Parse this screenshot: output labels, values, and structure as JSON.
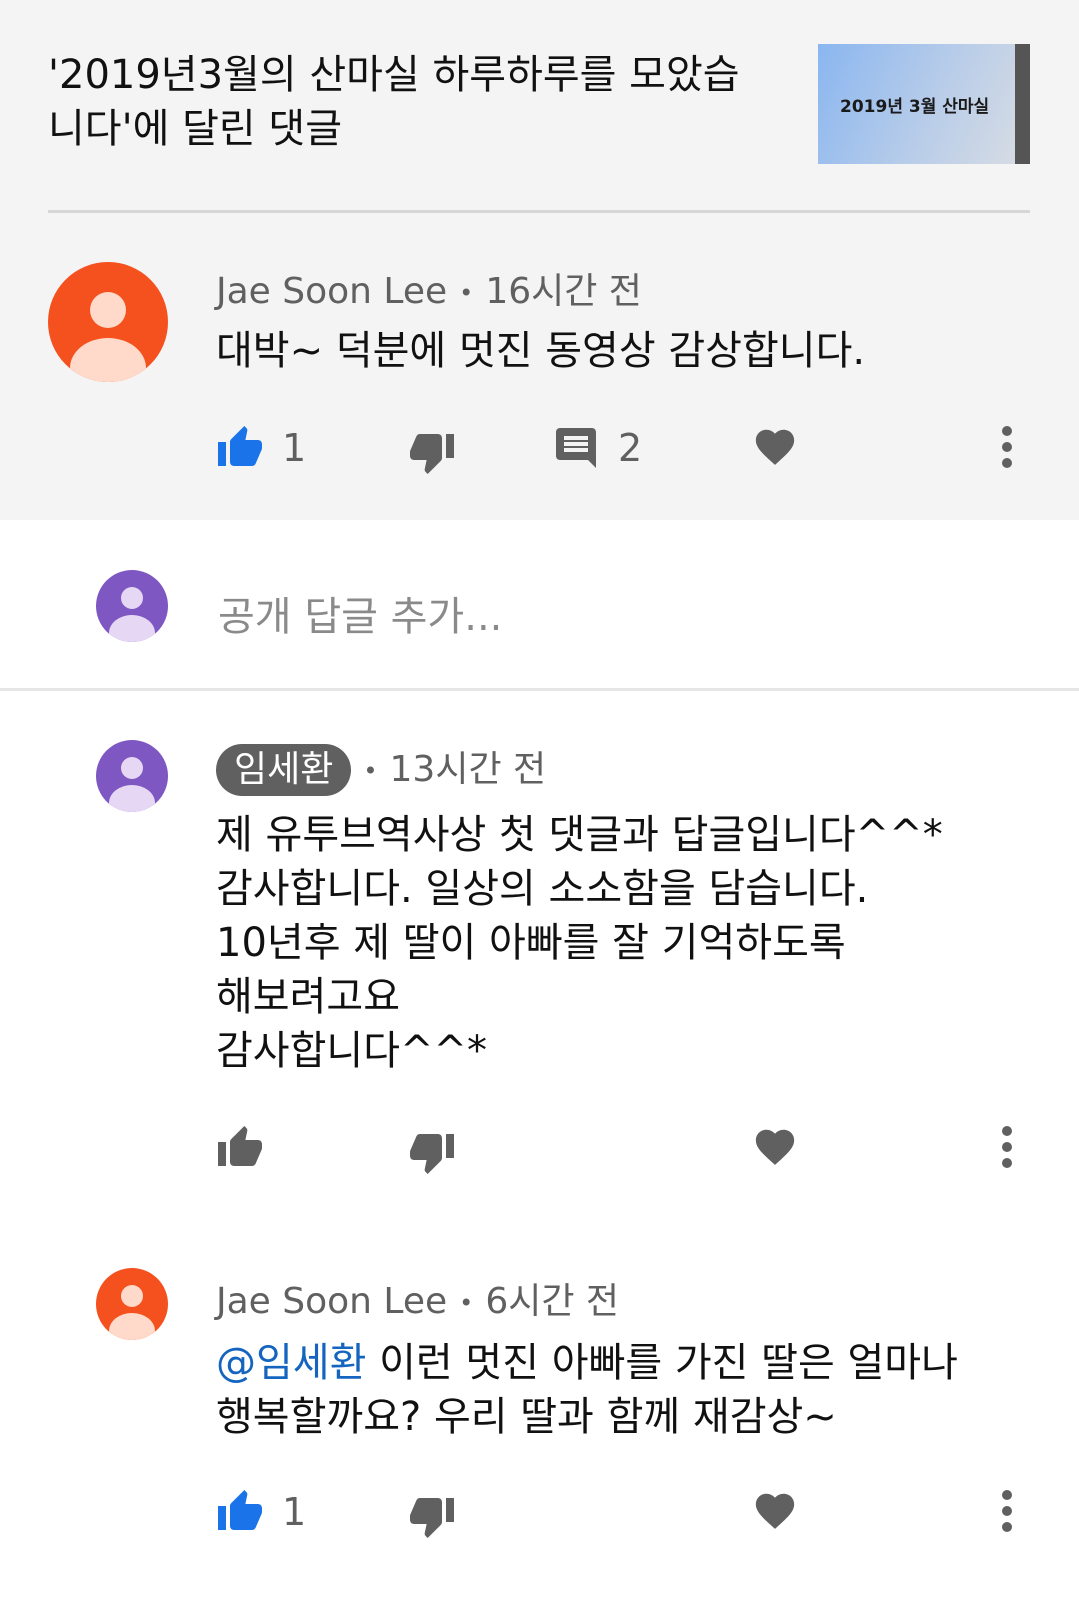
{
  "video": {
    "title": "'2019년3월의 산마실 하루하루를 모았습니다'에 달린 댓글",
    "thumbnail_text": "2019년 3월 산마실"
  },
  "main_comment": {
    "author": "Jae Soon Lee",
    "time": "16시간 전",
    "text": "대박~ 덕분에 멋진 동영상 감상합니다.",
    "likes": "1",
    "replies": "2",
    "avatar_color": "#f4511e"
  },
  "reply_box": {
    "placeholder": "공개 답글 추가...",
    "avatar_color": "#7e57c2"
  },
  "replies": [
    {
      "author": "임세환",
      "time": "13시간 전",
      "text": "제 유투브역사상 첫 댓글과 답글입니다^^*\n감사합니다. 일상의 소소함을 담습니다.\n10년후 제 딸이 아빠를 잘 기억하도록\n해보려고요\n감사합니다^^*",
      "avatar_color": "#7e57c2"
    },
    {
      "author": "Jae Soon Lee",
      "time": "6시간 전",
      "mention": "@임세환",
      "text": " 이런 멋진 아빠를 가진 딸은 얼마나\n행복할까요? 우리 딸과 함께 재감상~",
      "likes": "1",
      "avatar_color": "#f4511e"
    }
  ],
  "separator": "•",
  "colors": {
    "accent_blue": "#1a73e8",
    "icon_gray": "#606060"
  }
}
